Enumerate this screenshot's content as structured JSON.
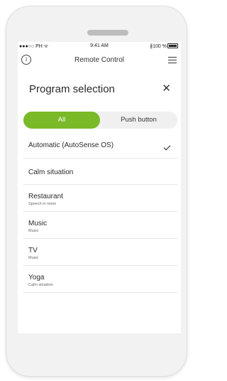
{
  "status_bar": {
    "carrier": "●●●○○ PH ᯤ",
    "time": "9:41 AM",
    "battery": "∦100 %"
  },
  "app_bar": {
    "title": "Remote Control",
    "info_icon": "info-circle-icon",
    "menu_icon": "hamburger-menu-icon"
  },
  "sheet": {
    "title": "Program selection",
    "close_symbol": "✕"
  },
  "tabs": [
    {
      "label": "All",
      "selected": true
    },
    {
      "label": "Push button",
      "selected": false
    }
  ],
  "accent_color": "#7ab927",
  "programs": [
    {
      "label": "Automatic (AutoSense OS)",
      "subtitle": "",
      "selected": true
    },
    {
      "label": "Calm situation",
      "subtitle": "",
      "selected": false
    },
    {
      "label": "Restaurant",
      "subtitle": "Speech in noise",
      "selected": false
    },
    {
      "label": "Music",
      "subtitle": "Music",
      "selected": false
    },
    {
      "label": "TV",
      "subtitle": "Music",
      "selected": false
    },
    {
      "label": "Yoga",
      "subtitle": "Calm situation",
      "selected": false
    }
  ]
}
